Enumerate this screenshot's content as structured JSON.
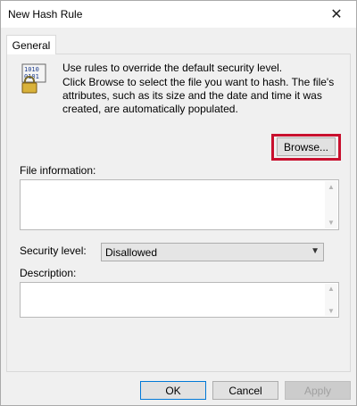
{
  "window": {
    "title": "New Hash Rule",
    "close_glyph": "✕"
  },
  "tabs": [
    {
      "label": "General"
    }
  ],
  "intro": {
    "line1": "Use rules to override the default security level.",
    "line2": "Click Browse to select the file you want to hash. The file's attributes, such as its size and the date and time it was created, are automatically populated."
  },
  "icon": {
    "name": "lock-binary-icon",
    "text": "1010\n0101"
  },
  "browse": {
    "label": "Browse..."
  },
  "file_info": {
    "label": "File information:",
    "value": ""
  },
  "security_level": {
    "label": "Security level:",
    "selected": "Disallowed"
  },
  "description": {
    "label": "Description:",
    "value": ""
  },
  "buttons": {
    "ok": "OK",
    "cancel": "Cancel",
    "apply": "Apply"
  },
  "colors": {
    "highlight": "#c8102e",
    "window_bg": "#f0f0f0"
  }
}
